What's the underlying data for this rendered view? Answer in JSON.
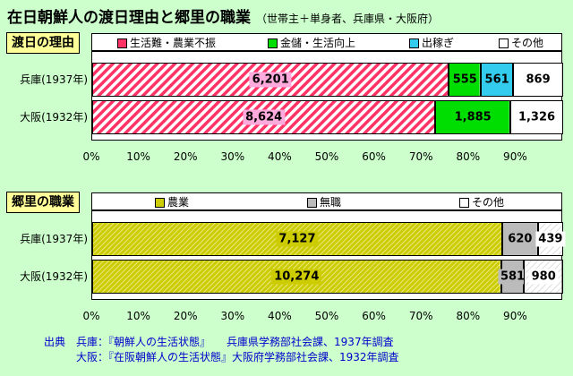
{
  "title": "在日朝鮮人の渡日理由と郷里の職業",
  "subtitle": "（世帯主＋単身者、兵庫県・大阪府）",
  "colors": {
    "background": "#ccffcc",
    "hatch_red": "#ff3366",
    "pink_label": "#ffaadd",
    "green": "#00dd00",
    "cyan": "#33ccee",
    "yellow": "#cccc00",
    "gray": "#bbbbbb",
    "white": "#ffffff"
  },
  "chart_data": [
    {
      "type": "bar",
      "orientation": "horizontal",
      "stacked": "percent",
      "title": "渡日の理由",
      "categories": [
        "兵庫(1937年)",
        "大阪(1932年)"
      ],
      "series": [
        {
          "name": "生活難・農業不振",
          "values": [
            6201,
            8624
          ]
        },
        {
          "name": "金儲・生活向上",
          "values": [
            555,
            1885
          ]
        },
        {
          "name": "出稼ぎ",
          "values": [
            561,
            0
          ]
        },
        {
          "name": "その他",
          "values": [
            869,
            1326
          ]
        }
      ],
      "xlim": [
        0,
        100
      ],
      "xticks": [
        "0%",
        "10%",
        "20%",
        "30%",
        "40%",
        "50%",
        "60%",
        "70%",
        "80%",
        "90%"
      ],
      "legend": "top"
    },
    {
      "type": "bar",
      "orientation": "horizontal",
      "stacked": "percent",
      "title": "郷里の職業",
      "categories": [
        "兵庫(1937年)",
        "大阪(1932年)"
      ],
      "series": [
        {
          "name": "農業",
          "values": [
            7127,
            10274
          ]
        },
        {
          "name": "無職",
          "values": [
            620,
            581
          ]
        },
        {
          "name": "その他",
          "values": [
            439,
            980
          ]
        }
      ],
      "xlim": [
        0,
        100
      ],
      "xticks": [
        "0%",
        "10%",
        "20%",
        "30%",
        "40%",
        "50%",
        "60%",
        "70%",
        "80%",
        "90%"
      ],
      "legend": "top"
    }
  ],
  "source": {
    "prefix": "出典",
    "line1": "兵庫：『朝鮮人の生活状態』　　兵庫県学務部社会課、1937年調査",
    "line2": "大阪：『在阪朝鮮人の生活状態』大阪府学務部社会課、1932年調査"
  }
}
